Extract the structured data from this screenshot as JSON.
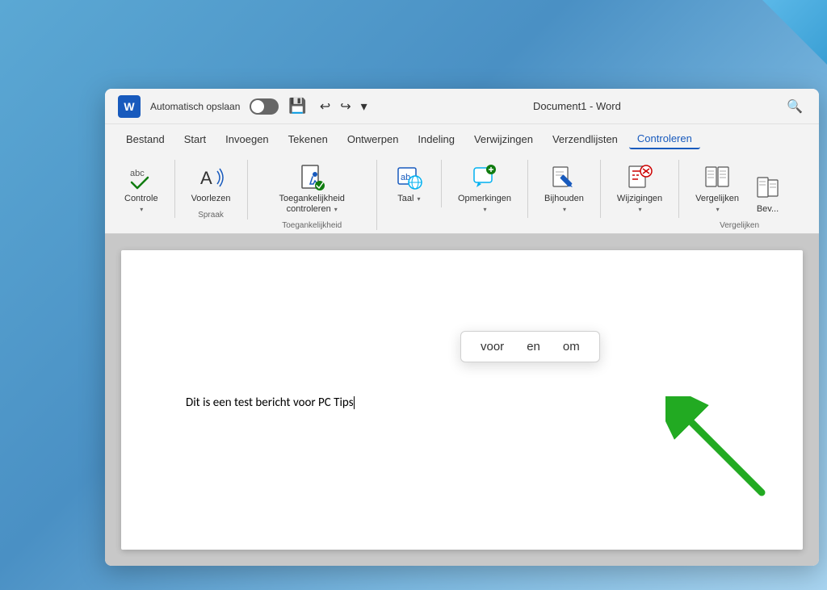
{
  "background": "#5ba8d4",
  "titlebar": {
    "word_icon": "W",
    "autosave_label": "Automatisch opslaan",
    "title": "Document1  -  Word",
    "search_placeholder": "Zoeken"
  },
  "menubar": {
    "items": [
      {
        "label": "Bestand",
        "active": false
      },
      {
        "label": "Start",
        "active": false
      },
      {
        "label": "Invoegen",
        "active": false
      },
      {
        "label": "Tekenen",
        "active": false
      },
      {
        "label": "Ontwerpen",
        "active": false
      },
      {
        "label": "Indeling",
        "active": false
      },
      {
        "label": "Verwijzingen",
        "active": false
      },
      {
        "label": "Verzendlijsten",
        "active": false
      },
      {
        "label": "Controleren",
        "active": true
      }
    ]
  },
  "ribbon": {
    "sections": [
      {
        "id": "section-controle",
        "buttons": [
          {
            "id": "btn-controle",
            "label": "Controle",
            "icon": "✓",
            "has_dropdown": true
          }
        ],
        "section_label": ""
      },
      {
        "id": "section-spraak",
        "buttons": [
          {
            "id": "btn-voorlezen",
            "label": "Voorlezen",
            "icon": "A♪",
            "has_dropdown": false
          }
        ],
        "section_label": "Spraak"
      },
      {
        "id": "section-toegankelijkheid",
        "buttons": [
          {
            "id": "btn-toegankelijkheid",
            "label": "Toegankelijkheid controleren",
            "icon": "📄✓",
            "has_dropdown": true
          }
        ],
        "section_label": "Toegankelijkheid"
      },
      {
        "id": "section-taal",
        "buttons": [
          {
            "id": "btn-taal",
            "label": "Taal",
            "icon": "🌐",
            "has_dropdown": true
          }
        ],
        "section_label": ""
      },
      {
        "id": "section-opmerkingen",
        "buttons": [
          {
            "id": "btn-opmerkingen",
            "label": "Opmerkingen",
            "icon": "💬",
            "has_dropdown": true
          }
        ],
        "section_label": ""
      },
      {
        "id": "section-bijhouden",
        "buttons": [
          {
            "id": "btn-bijhouden",
            "label": "Bijhouden",
            "icon": "✏️",
            "has_dropdown": true
          }
        ],
        "section_label": ""
      },
      {
        "id": "section-wijzigingen",
        "buttons": [
          {
            "id": "btn-wijzigingen",
            "label": "Wijzigingen",
            "icon": "✗",
            "has_dropdown": true
          }
        ],
        "section_label": ""
      },
      {
        "id": "section-vergelijken",
        "buttons": [
          {
            "id": "btn-vergelijken",
            "label": "Vergelijken",
            "icon": "▤",
            "has_dropdown": true
          }
        ],
        "section_label": "Vergelijken"
      },
      {
        "id": "section-bev",
        "buttons": [
          {
            "id": "btn-bev",
            "label": "Bev...",
            "icon": "▤",
            "has_dropdown": false
          }
        ],
        "section_label": ""
      }
    ]
  },
  "document": {
    "text": "Dit is een test bericht voor PC Tips",
    "cursor": true
  },
  "autocomplete": {
    "options": [
      "voor",
      "en",
      "om"
    ]
  }
}
